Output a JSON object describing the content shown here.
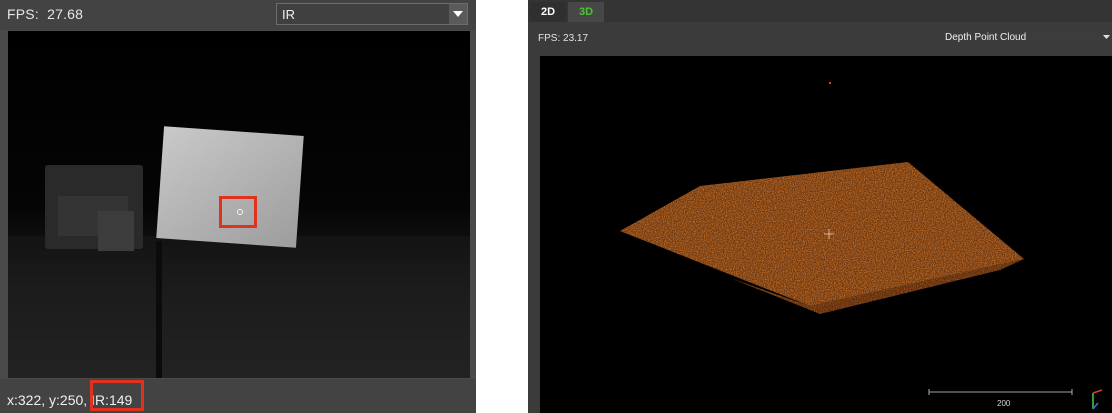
{
  "left_panel": {
    "fps_label": "FPS:",
    "fps_value": "27.68",
    "stream_select": {
      "selected": "IR"
    },
    "status": {
      "coords": "x:322, y:250, IR:149"
    },
    "accent_color": "#e0321f"
  },
  "right_panel": {
    "tabs": [
      {
        "label": "2D",
        "active": false,
        "color": "#ffffff"
      },
      {
        "label": "3D",
        "active": true,
        "color": "#4cc234"
      }
    ],
    "fps_text": "FPS: 23.17",
    "view_select": {
      "selected": "Depth Point Cloud"
    },
    "scale_bar": {
      "label": "200"
    },
    "point_color": "#e07a2a",
    "axis_colors": {
      "x": "#e03a2a",
      "y": "#3ec43e",
      "z": "#3a6ae0"
    }
  }
}
